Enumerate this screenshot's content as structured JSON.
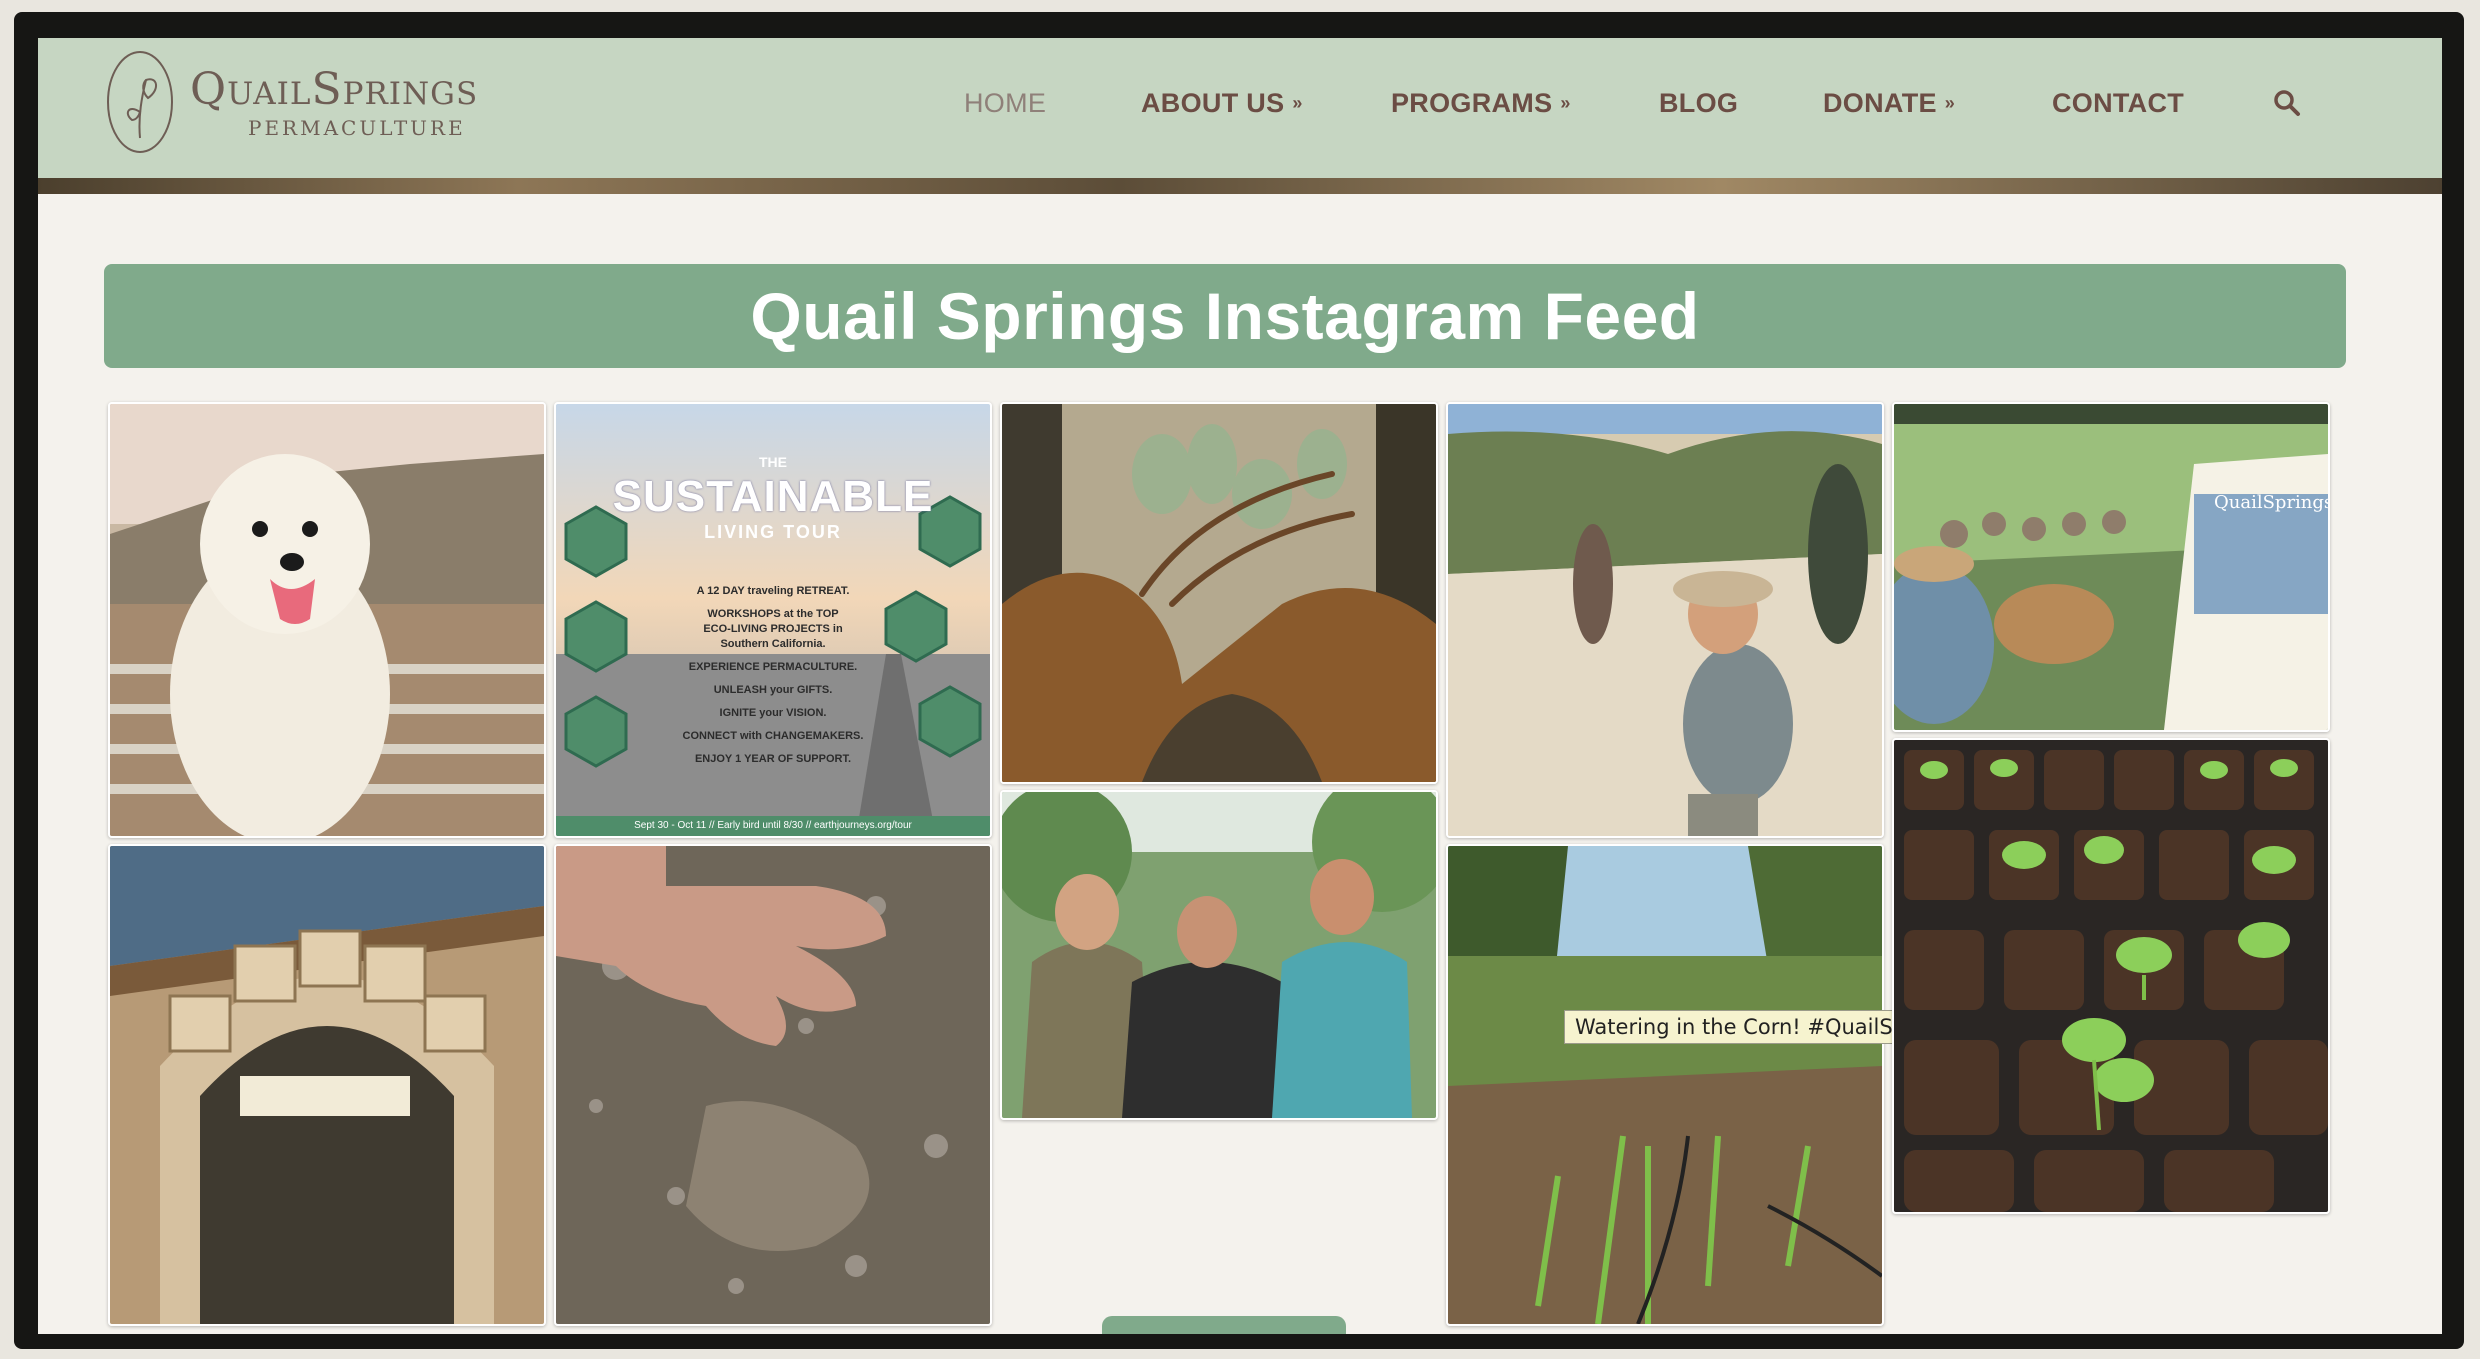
{
  "site": {
    "logo_name": "QuailSprings",
    "logo_sub": "PERMACULTURE"
  },
  "nav": {
    "items": [
      {
        "label": "HOME"
      },
      {
        "label": "ABOUT US",
        "chevron": "»"
      },
      {
        "label": "PROGRAMS",
        "chevron": "»"
      },
      {
        "label": "BLOG"
      },
      {
        "label": "DONATE",
        "chevron": "»"
      },
      {
        "label": "CONTACT"
      }
    ],
    "search_icon": "search-icon"
  },
  "feed": {
    "title": "Quail Springs Instagram Feed",
    "tooltip": "Watering in the Corn! #QuailSprings",
    "poster": {
      "banner": "THE",
      "title": "SUSTAINABLE",
      "subtitle": "LIVING TOUR",
      "lines": [
        "A 12 DAY traveling RETREAT.",
        "WORKSHOPS at the TOP",
        "ECO-LIVING PROJECTS in",
        "Southern California.",
        "EXPERIENCE PERMACULTURE.",
        "UNLEASH your GIFTS.",
        "IGNITE your VISION.",
        "CONNECT with CHANGEMAKERS.",
        "ENJOY 1 YEAR OF SUPPORT."
      ],
      "footer": "Sept 30 - Oct 11 // Early bird until 8/30 // earthjourneys.org/tour"
    },
    "sign_text": "QuailSprings"
  },
  "colors": {
    "header_bg": "#c6d6c2",
    "accent_green": "#80aa8b",
    "nav_text": "#6b4d44"
  }
}
